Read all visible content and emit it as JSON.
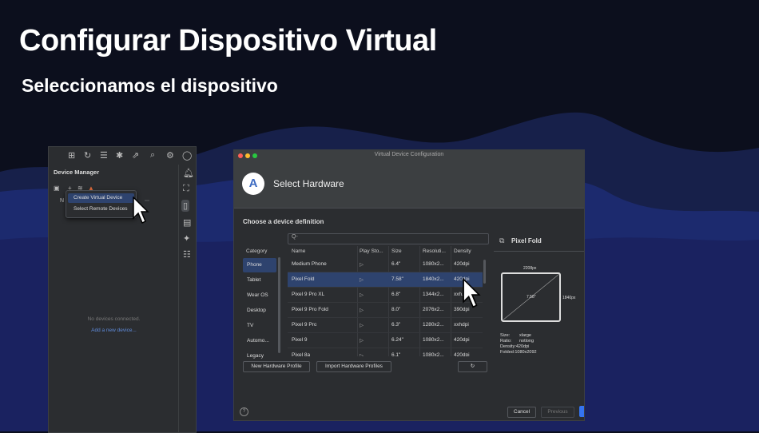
{
  "slide": {
    "title": "Configurar Dispositivo Virtual",
    "subtitle": "Seleccionamos el dispositivo"
  },
  "colors": {
    "accent": "#3574f0",
    "selection": "#2e436e",
    "panel": "#2b2d30",
    "background": "#0c0f1d"
  },
  "device_manager": {
    "title": "Device Manager",
    "name_col_clip": "N",
    "menu": [
      "Create Virtual Device",
      "Select Remote Devices"
    ],
    "empty_text": "No devices connected.",
    "add_link": "Add a new device..."
  },
  "dialog": {
    "window_title": "Virtual Device Configuration",
    "header_title": "Select Hardware",
    "section_label": "Choose a device definition",
    "search_placeholder": "Q-",
    "categories_header": "Category",
    "categories": [
      "Phone",
      "Tablet",
      "Wear OS",
      "Desktop",
      "TV",
      "Automo...",
      "Legacy"
    ],
    "selected_category": "Phone",
    "columns": [
      "Name",
      "Play Sto...",
      "Size",
      "Resoluti...",
      "Density"
    ],
    "rows": [
      {
        "name": "Medium Phone",
        "size": "6.4\"",
        "resolution": "1080x2...",
        "density": "420dpi"
      },
      {
        "name": "Pixel Fold",
        "size": "7.58\"",
        "resolution": "1840x2...",
        "density": "420dpi"
      },
      {
        "name": "Pixel 9 Pro XL",
        "size": "6.8\"",
        "resolution": "1344x2...",
        "density": "xxh..."
      },
      {
        "name": "Pixel 9 Pro Fold",
        "size": "8.0\"",
        "resolution": "2076x2...",
        "density": "390dpi"
      },
      {
        "name": "Pixel 9 Pro",
        "size": "6.3\"",
        "resolution": "1280x2...",
        "density": "xxhdpi"
      },
      {
        "name": "Pixel 9",
        "size": "6.24\"",
        "resolution": "1080x2...",
        "density": "420dpi"
      },
      {
        "name": "Pixel 8a",
        "size": "6.1\"",
        "resolution": "1080x2...",
        "density": "420dpi"
      }
    ],
    "selected_row": "Pixel Fold",
    "buttons": {
      "new_profile": "New Hardware Profile",
      "import_profiles": "Import Hardware Profiles",
      "cancel": "Cancel",
      "previous": "Previous"
    },
    "preview": {
      "title": "Pixel Fold",
      "width_label": "2208px",
      "height_label": "1840px",
      "diag_label": "7.58\"",
      "specs": [
        {
          "k": "Size:",
          "v": "xlarge"
        },
        {
          "k": "Ratio:",
          "v": "notlong"
        },
        {
          "k": "Density:",
          "v": "420dpi"
        },
        {
          "k": "Folded:",
          "v": "1080x2092"
        }
      ]
    },
    "help": "?"
  }
}
